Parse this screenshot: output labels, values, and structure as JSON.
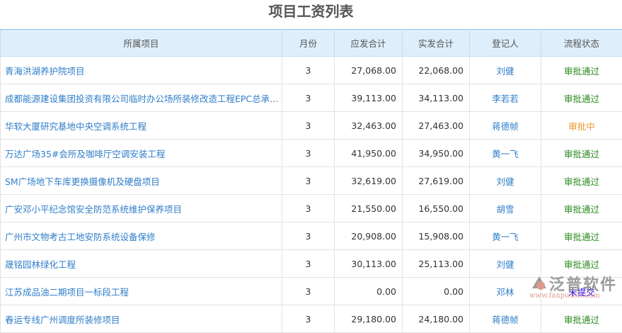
{
  "title": "项目工资列表",
  "columns": [
    "所属项目",
    "月份",
    "应发合计",
    "实发合计",
    "登记人",
    "流程状态"
  ],
  "rows": [
    [
      "青海洪湖养护院项目",
      "3",
      "27,068.00",
      "22,068.00",
      "刘健",
      "审批通过",
      "ok"
    ],
    [
      "成都能源建设集团投资有限公司临时办公场所装修改造工程EPC总承包项目",
      "3",
      "39,113.00",
      "34,113.00",
      "李若若",
      "审批通过",
      "ok"
    ],
    [
      "华软大厦研究基地中央空调系统工程",
      "3",
      "32,463.00",
      "27,463.00",
      "蒋德帧",
      "审批中",
      "mid"
    ],
    [
      "万达广场35#会所及咖啡厅空调安装工程",
      "3",
      "41,950.00",
      "34,950.00",
      "黄一飞",
      "审批通过",
      "ok"
    ],
    [
      "SM广场地下车库更换摄像机及硬盘项目",
      "3",
      "32,619.00",
      "27,619.00",
      "刘健",
      "审批通过",
      "ok"
    ],
    [
      "广安邓小平纪念馆安全防范系统维护保养项目",
      "3",
      "21,550.00",
      "16,550.00",
      "胡雪",
      "审批通过",
      "ok"
    ],
    [
      "广州市文物考古工地安防系统设备保修",
      "3",
      "20,908.00",
      "15,908.00",
      "黄一飞",
      "审批通过",
      "ok"
    ],
    [
      "晟铭园林绿化工程",
      "3",
      "30,113.00",
      "25,113.00",
      "刘健",
      "审批通过",
      "ok"
    ],
    [
      "江苏成品油二期项目一标段工程",
      "3",
      "0.00",
      "0.00",
      "邓林",
      "未提交",
      "no"
    ],
    [
      "春运专线广州调度所装修项目",
      "3",
      "29,180.00",
      "24,180.00",
      "蒋德帧",
      "审批通过",
      "ok"
    ]
  ],
  "watermark": {
    "brand": "泛普软件",
    "url": "www.fanpusoft.com"
  }
}
